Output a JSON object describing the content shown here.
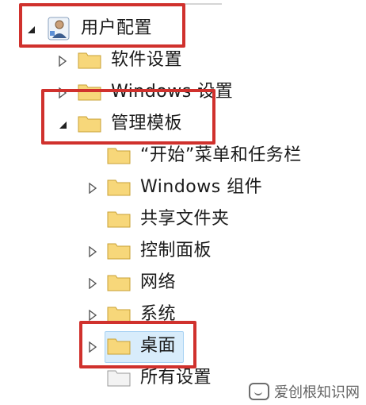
{
  "tree": {
    "root": {
      "label": "用户配置",
      "icon": "user-config-icon",
      "expanded": true
    },
    "items": [
      {
        "label": "软件设置",
        "expandable": true
      },
      {
        "label": "Windows 设置",
        "expandable": true
      },
      {
        "label": "管理模板",
        "expandable": true,
        "expanded": true
      },
      {
        "label": "“开始”菜单和任务栏",
        "expandable": false
      },
      {
        "label": "Windows 组件",
        "expandable": true
      },
      {
        "label": "共享文件夹",
        "expandable": false
      },
      {
        "label": "控制面板",
        "expandable": true
      },
      {
        "label": "网络",
        "expandable": true
      },
      {
        "label": "系统",
        "expandable": true
      },
      {
        "label": "桌面",
        "expandable": true,
        "selected": true
      },
      {
        "label": "所有设置",
        "expandable": false
      }
    ]
  },
  "watermark": {
    "text": "爱创根知识网"
  },
  "colors": {
    "highlight": "#d0312d",
    "folder": "#f7d77a",
    "selected_bg": "#d8ecfb"
  }
}
